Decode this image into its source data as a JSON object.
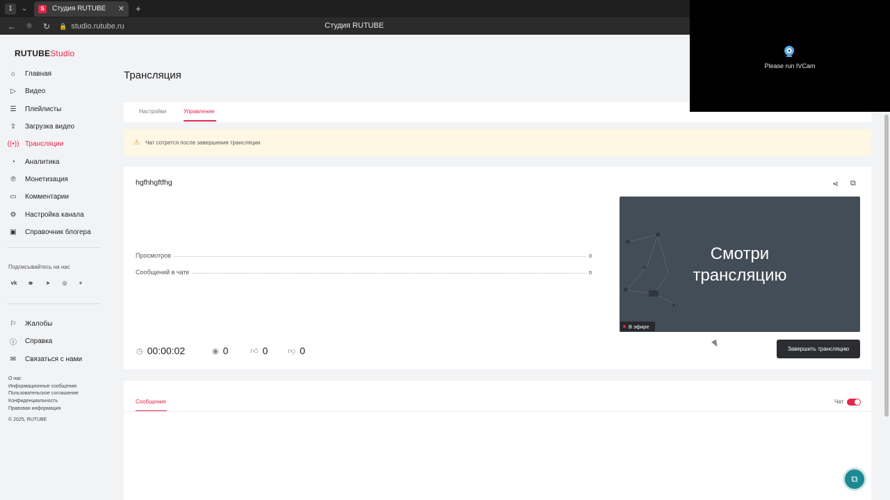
{
  "browser": {
    "tab_title": "Студия RUTUBE",
    "tab_favicon": "S",
    "url": "studio.rutube.ru",
    "page_title": "Студия RUTUBE",
    "workspace_badge": "1"
  },
  "overlay": {
    "message": "Please run IVCam"
  },
  "logo": {
    "brand": "RUTUBE",
    "suffix": "Studio",
    "accent_color": "#e8254a"
  },
  "sidebar": {
    "items": [
      {
        "label": "Главная",
        "icon": "home-icon"
      },
      {
        "label": "Видео",
        "icon": "video-icon"
      },
      {
        "label": "Плейлисты",
        "icon": "playlist-icon"
      },
      {
        "label": "Загрузка видео",
        "icon": "upload-icon"
      },
      {
        "label": "Трансляции",
        "icon": "broadcast-icon",
        "active": true
      },
      {
        "label": "Аналитика",
        "icon": "analytics-icon"
      },
      {
        "label": "Монетизация",
        "icon": "monetization-icon"
      },
      {
        "label": "Комментарии",
        "icon": "comments-icon"
      },
      {
        "label": "Настройка канала",
        "icon": "gear-icon"
      },
      {
        "label": "Справочник блогера",
        "icon": "book-icon"
      }
    ],
    "subscribe_label": "Подписывайтесь на нас",
    "social": [
      "VK",
      "OK",
      "Telegram",
      "Viber",
      "+"
    ],
    "bottom_items": [
      {
        "label": "Жалобы",
        "icon": "flag-icon"
      },
      {
        "label": "Справка",
        "icon": "help-icon"
      },
      {
        "label": "Связаться с нами",
        "icon": "mail-icon"
      }
    ],
    "footer_links": [
      "О нас",
      "Информационные сообщения",
      "Пользовательское соглашение",
      "Конфиденциальность",
      "Правовая информация"
    ],
    "copyright": "© 2025, RUTUBE"
  },
  "main": {
    "title": "Трансляция",
    "tabs": [
      {
        "label": "Настройки",
        "active": false
      },
      {
        "label": "Управление",
        "active": true
      }
    ],
    "warning": "Чат сотрется после завершения трансляции",
    "stream": {
      "name": "hgfhhgftfhg",
      "stats": [
        {
          "label": "Просмотров",
          "value": "0"
        },
        {
          "label": "Сообщений в чате",
          "value": "0"
        }
      ],
      "preview_text_line1": "Смотри",
      "preview_text_line2": "трансляцию",
      "live_badge": "В эфире",
      "duration": "00:00:02",
      "viewers": "0",
      "likes": "0",
      "dislikes": "0",
      "finish_button": "Завершить трансляцию"
    },
    "messages": {
      "tab_label": "Сообщения",
      "chat_label": "Чат",
      "chat_enabled": true
    }
  }
}
